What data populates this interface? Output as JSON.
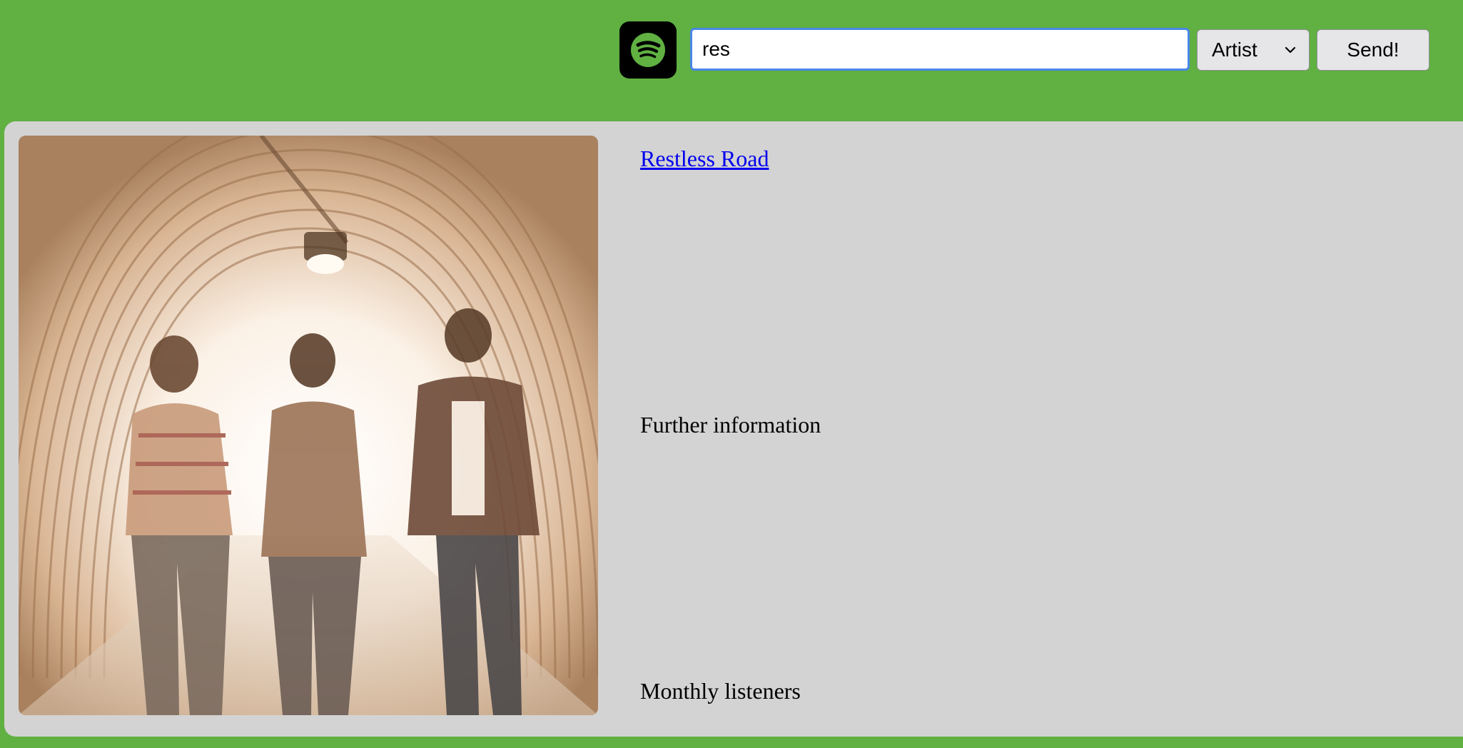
{
  "header": {
    "logo_icon": "spotify-logo-icon",
    "search": {
      "value": "res",
      "placeholder": ""
    },
    "type_select": {
      "selected": "Artist",
      "options": [
        "Artist"
      ]
    },
    "send_label": "Send!"
  },
  "result": {
    "artist_name": "Restless Road",
    "further_info_label": "Further information",
    "monthly_listeners_label": "Monthly listeners"
  },
  "colors": {
    "background_green": "#60b042",
    "panel_gray": "#d3d3d3",
    "link_blue": "#0000ee",
    "focus_blue": "#4a86e8"
  }
}
